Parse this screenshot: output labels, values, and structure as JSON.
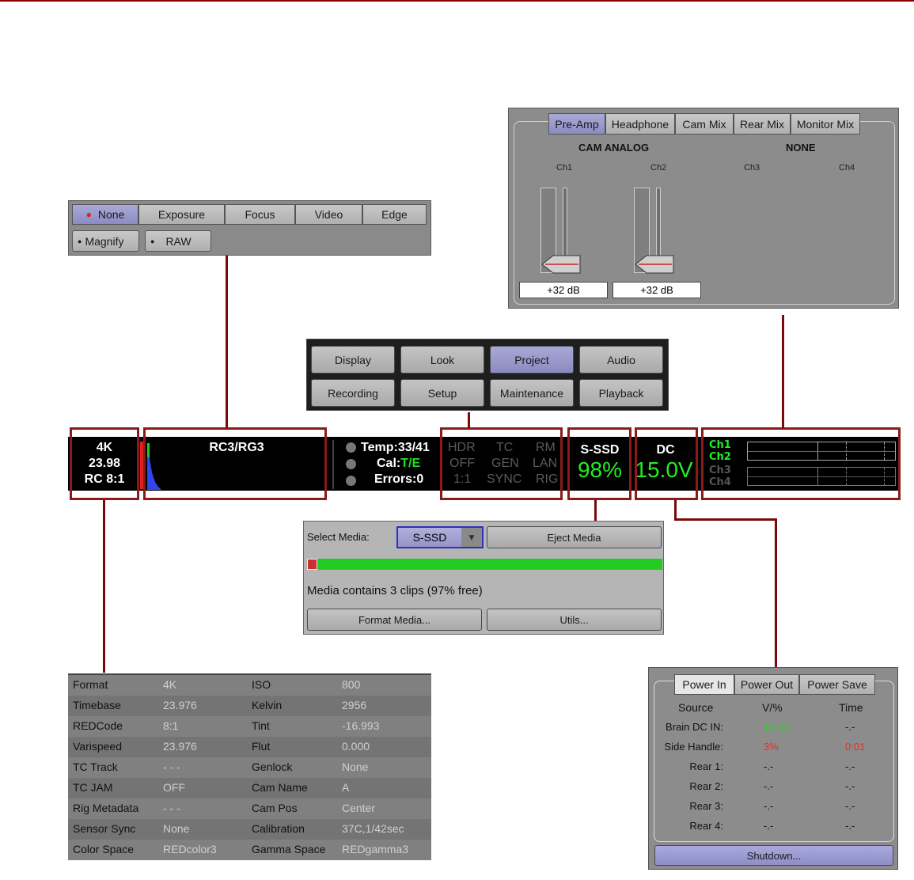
{
  "tools_menu": {
    "row1": [
      "None",
      "Exposure",
      "Focus",
      "Video",
      "Edge"
    ],
    "row2": [
      "Magnify",
      "RAW"
    ]
  },
  "audio_panel": {
    "tabs": [
      "Pre-Amp",
      "Headphone",
      "Cam Mix",
      "Rear Mix",
      "Monitor Mix"
    ],
    "left_source": "CAM ANALOG",
    "right_source": "NONE",
    "channels": [
      "Ch1",
      "Ch2",
      "Ch3",
      "Ch4"
    ],
    "gain_ch1": "+32 dB",
    "gain_ch2": "+32 dB"
  },
  "main_menu": {
    "row1": [
      "Display",
      "Look",
      "Project",
      "Audio"
    ],
    "row2": [
      "Recording",
      "Setup",
      "Maintenance",
      "Playback"
    ]
  },
  "status_bar": {
    "format": "4K",
    "fps": "23.98",
    "redcode": "RC 8:1",
    "look": "RC3/RG3",
    "temp": "Temp:33/41",
    "cal_label": "Cal:",
    "cal_value": "T/E",
    "errors": "Errors:0",
    "grid": [
      [
        "HDR",
        "TC",
        "RM"
      ],
      [
        "OFF",
        "GEN",
        "LAN"
      ],
      [
        "1:1",
        "SYNC",
        "RIG"
      ]
    ],
    "media_label": "S-SSD",
    "media_pct": "98%",
    "power_label": "DC",
    "power_value": "15.0V",
    "audio_channels": [
      "Ch1",
      "Ch2",
      "Ch3",
      "Ch4"
    ]
  },
  "media_panel": {
    "select_label": "Select Media:",
    "select_value": "S-SSD",
    "eject": "Eject Media",
    "info": "Media contains 3 clips (97% free)",
    "format_btn": "Format Media...",
    "utils_btn": "Utils...",
    "used_fraction": 0.03
  },
  "metadata": {
    "rows": [
      [
        "Format",
        "4K",
        "ISO",
        "800"
      ],
      [
        "Timebase",
        "23.976",
        "Kelvin",
        "2956"
      ],
      [
        "REDCode",
        "8:1",
        "Tint",
        "-16.993"
      ],
      [
        "Varispeed",
        "23.976",
        "Flut",
        "0.000"
      ],
      [
        "TC Track",
        "- - -",
        "Genlock",
        "None"
      ],
      [
        "TC JAM",
        "OFF",
        "Cam Name",
        "A"
      ],
      [
        "Rig Metadata",
        "- - -",
        "Cam Pos",
        "Center"
      ],
      [
        "Sensor Sync",
        "None",
        "Calibration",
        "37C,1/42sec"
      ],
      [
        "Color Space",
        "REDcolor3",
        "Gamma Space",
        "REDgamma3"
      ]
    ]
  },
  "power_panel": {
    "tabs": [
      "Power In",
      "Power Out",
      "Power Save"
    ],
    "headers": [
      "Source",
      "V/%",
      "Time"
    ],
    "rows": [
      {
        "name": "Brain DC IN:",
        "v": "15.0V",
        "t": "-.-"
      },
      {
        "name": "Side Handle:",
        "v": "3%",
        "t": "0:01"
      },
      {
        "name": "Rear 1:",
        "v": "-.-",
        "t": "-.-"
      },
      {
        "name": "Rear 2:",
        "v": "-.-",
        "t": "-.-"
      },
      {
        "name": "Rear 3:",
        "v": "-.-",
        "t": "-.-"
      },
      {
        "name": "Rear 4:",
        "v": "-.-",
        "t": "-.-"
      }
    ],
    "shutdown": "Shutdown...",
    "colors": {
      "ok": "#33cc33",
      "warn": "#e03030"
    }
  }
}
